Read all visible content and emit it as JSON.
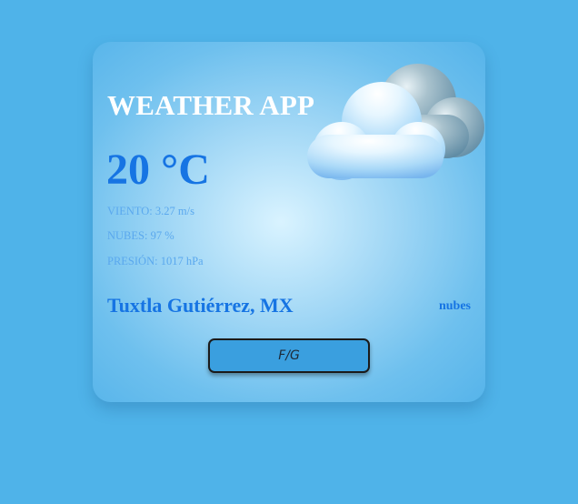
{
  "app": {
    "title": "WEATHER APP"
  },
  "weather": {
    "temperature": "20 °C",
    "wind": "VIENTO: 3.27 m/s",
    "clouds": "NUBES: 97 %",
    "pressure": "PRESIÓN: 1017 hPa",
    "location": "Tuxtla Gutiérrez, MX",
    "description": "nubes",
    "icon": "cloud-icon"
  },
  "controls": {
    "unit_toggle_label": "F/G"
  },
  "colors": {
    "background": "#4fb3e9",
    "accent_text": "#1674e3",
    "button": "#3a9fdf"
  }
}
